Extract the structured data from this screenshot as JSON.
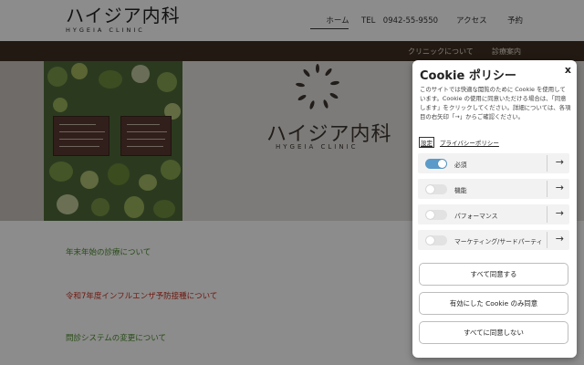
{
  "header": {
    "logo_main": "ハイジア内科",
    "logo_sub": "HYGEIA CLINIC",
    "nav": {
      "home": "ホーム",
      "tel": "TEL　0942-55-9550",
      "access": "アクセス",
      "reserve": "予約"
    }
  },
  "subbar": {
    "clinic": "クリニックについて",
    "guide": "診療案内"
  },
  "hero": {
    "logo_main": "ハイジア内科",
    "logo_sub": "HYGEIA CLINIC"
  },
  "news": [
    {
      "text": "年末年始の診療について",
      "color": "#4a8a2a"
    },
    {
      "text": "令和7年度インフルエンザ予防接種について",
      "color": "#cc2a1a"
    },
    {
      "text": "問診システムの変更について",
      "color": "#4a8a2a"
    }
  ],
  "cookie": {
    "title": "Cookie ポリシー",
    "close": "x",
    "description": "このサイトでは快適な閲覧のために Cookie を使用しています。Cookie の使用に同意いただける場合は、「同意します」をクリックしてください。詳細については、各項目の右矢印「→」からご確認ください。",
    "link_settings": "設定",
    "link_privacy": "プライバシーポリシー",
    "categories": [
      {
        "label": "必須",
        "on": true
      },
      {
        "label": "機能",
        "on": false
      },
      {
        "label": "パフォーマンス",
        "on": false
      },
      {
        "label": "マーケティング/サードパーティ",
        "on": false
      }
    ],
    "arrow": "→",
    "buttons": {
      "accept_all": "すべて同意する",
      "accept_selected": "有効にした Cookie のみ同意",
      "reject_all": "すべてに同意しない"
    }
  }
}
